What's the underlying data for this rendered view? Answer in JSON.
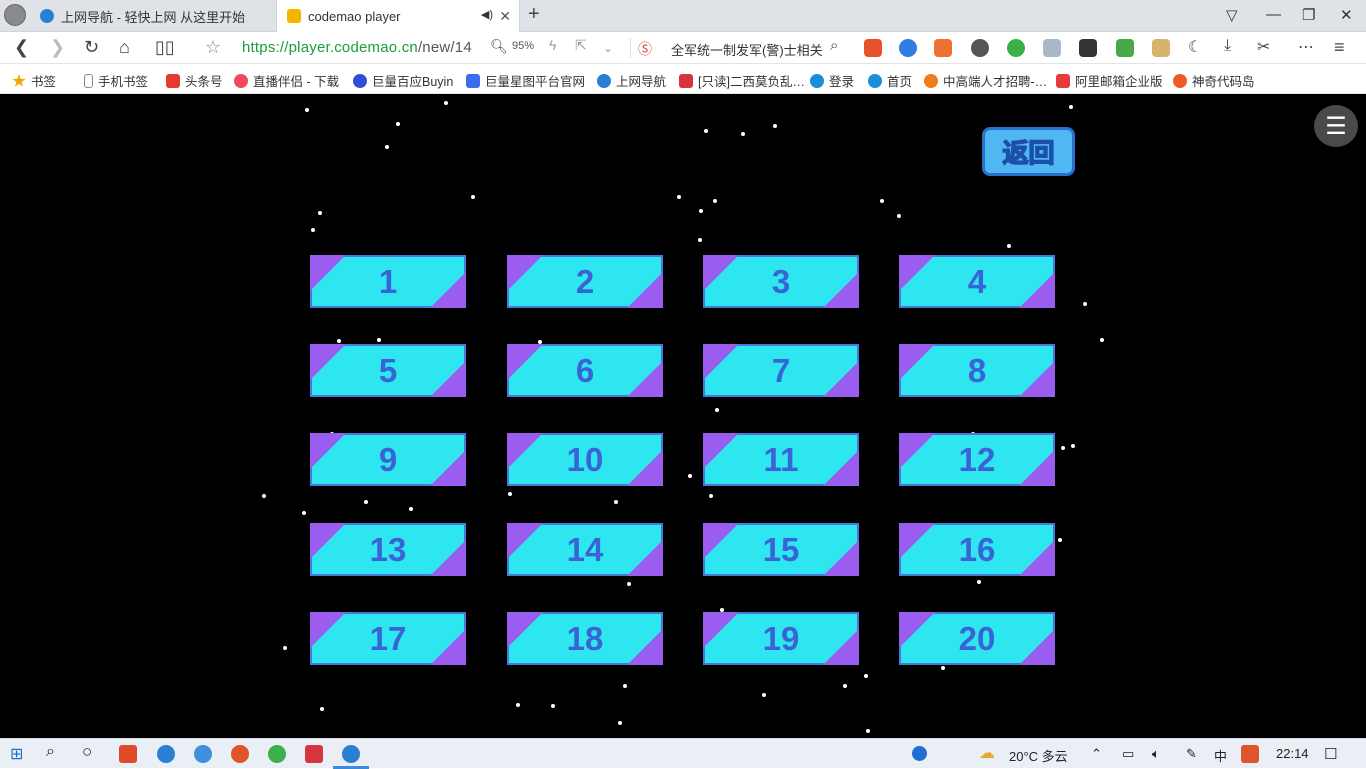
{
  "browser": {
    "tabs": [
      {
        "title": "上网导航 - 轻快上网 从这里开始",
        "color": "#2a7fd4"
      },
      {
        "title": "codemao player",
        "color": "#f5b400"
      }
    ],
    "new_tab": "+",
    "url": {
      "scheme_host": "https://player.codemao.cn",
      "path": "/new/14"
    },
    "zoom": "95%",
    "search_text": "全军统一制发军(警)士相关",
    "bookmarks": [
      {
        "label": "书签",
        "color": "#f0a500"
      },
      {
        "label": "手机书签",
        "color": "#888888"
      },
      {
        "label": "头条号",
        "color": "#e33b2f"
      },
      {
        "label": "直播伴侣 - 下载",
        "color": "#f04a5a"
      },
      {
        "label": "巨量百应Buyin",
        "color": "#2c4fd6"
      },
      {
        "label": "巨量星图平台官网",
        "color": "#3d6cf0"
      },
      {
        "label": "上网导航",
        "color": "#2a7fd4"
      },
      {
        "label": "[只读]二西莫负乱…",
        "color": "#d8343e"
      },
      {
        "label": "登录",
        "color": "#1a8ed8"
      },
      {
        "label": "首页",
        "color": "#1a8ed8"
      },
      {
        "label": "中高端人才招聘-…",
        "color": "#f07b1a"
      },
      {
        "label": "阿里邮箱企业版",
        "color": "#e83c3c"
      },
      {
        "label": "神奇代码岛",
        "color": "#f05a28"
      }
    ]
  },
  "game": {
    "back_label": "返回",
    "menu_icon": "☰",
    "levels": [
      "1",
      "2",
      "3",
      "4",
      "5",
      "6",
      "7",
      "8",
      "9",
      "10",
      "11",
      "12",
      "13",
      "14",
      "15",
      "16",
      "17",
      "18",
      "19",
      "20"
    ],
    "colors": {
      "tile": "#2de6ef",
      "corner": "#9b5cf0",
      "text": "#3a63d6",
      "background": "#000000"
    }
  },
  "taskbar": {
    "weather": "20°C 多云",
    "ime": "中",
    "time": "22:14"
  }
}
